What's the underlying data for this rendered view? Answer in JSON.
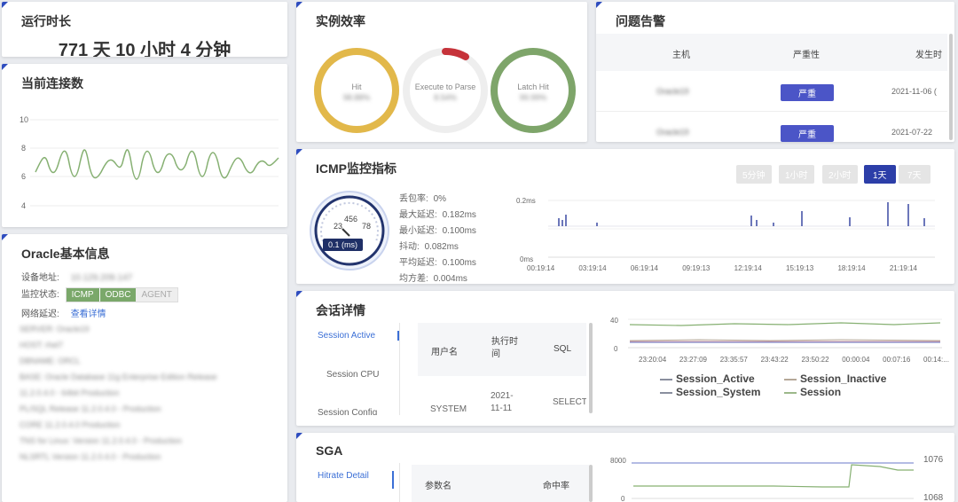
{
  "uptime": {
    "title": "运行时长",
    "value": "771 天 10 小时 4 分钟"
  },
  "connections": {
    "title": "当前连接数",
    "y_ticks": [
      "10",
      "8",
      "6",
      "4"
    ]
  },
  "oracle_info": {
    "title": "Oracle基本信息",
    "device_label": "设备地址:",
    "device_value": "10.129.209.147",
    "monitor_label": "监控状态:",
    "monitor_states": [
      "ICMP",
      "ODBC",
      "AGENT"
    ],
    "network_label": "网络延迟:",
    "network_link": "查看详情",
    "blurred_lines": [
      "SERVER: Oracle19",
      "HOST: rhel7",
      "DBNAME: ORCL",
      "BASE: Oracle Database 11g Enterprise Edition Release",
      "11.2.0.4.0 - 64bit Production",
      "PL/SQL Release 11.2.0.4.0 - Production",
      "CORE 11.2.0.4.0 Production",
      "TNS for Linux: Version 11.2.0.4.0 - Production",
      "NLSRTL Version 11.2.0.4.0 - Production"
    ]
  },
  "efficiency": {
    "title": "实例效率",
    "rings": [
      {
        "label": "Hit",
        "value": "98.88%",
        "color": "#e2b84a",
        "percent": 100
      },
      {
        "label": "Execute to Parse",
        "value": "8.54%",
        "color": "#c6333a",
        "percent": 8
      },
      {
        "label": "Latch Hit",
        "value": "99.99%",
        "color": "#7ea56a",
        "percent": 100
      }
    ]
  },
  "alerts": {
    "title": "问题告警",
    "headers": [
      "主机",
      "严重性",
      "发生时"
    ],
    "rows": [
      {
        "host": "Oracle19",
        "severity": "严重",
        "time": "2021-11-06 ("
      },
      {
        "host": "Oracle19",
        "severity": "严重",
        "time": "2021-07-22"
      }
    ]
  },
  "icmp": {
    "title": "ICMP监控指标",
    "ranges": [
      "5分钟",
      "1小时",
      "2小时",
      "1天",
      "7天"
    ],
    "active_range": "1天",
    "gauge_value": "0.1 (ms)",
    "stats": [
      {
        "label": "丢包率:",
        "value": "0%"
      },
      {
        "label": "最大延迟:",
        "value": "0.182ms"
      },
      {
        "label": "最小延迟:",
        "value": "0.100ms"
      },
      {
        "label": "抖动:",
        "value": "0.082ms"
      },
      {
        "label": "平均延迟:",
        "value": "0.100ms"
      },
      {
        "label": "均方差:",
        "value": "0.004ms"
      }
    ],
    "y_ticks": [
      "0.2ms",
      "0ms"
    ],
    "x_ticks": [
      "00:19:14",
      "03:19:14",
      "06:19:14",
      "09:19:13",
      "12:19:14",
      "15:19:13",
      "18:19:14",
      "21:19:14"
    ]
  },
  "sessions": {
    "title": "会话详情",
    "tabs": [
      "Session Active",
      "Session CPU",
      "Session Config"
    ],
    "headers": [
      "用户名",
      "执行时间",
      "SQL"
    ],
    "row": {
      "user": "SYSTEM",
      "time": "2021-11-11",
      "sql": "SELECT"
    },
    "y_ticks": [
      "40",
      "0"
    ],
    "x_ticks": [
      "23:20:04",
      "23:27:09",
      "23:35:57",
      "23:43:22",
      "23:50:22",
      "00:00:04",
      "00:07:16",
      "00:14:..."
    ],
    "legend": [
      "Session_Active",
      "Session_Inactive",
      "Session_System",
      "Session"
    ]
  },
  "sga": {
    "title": "SGA",
    "tab": "Hitrate Detail",
    "headers": [
      "参数名",
      "命中率"
    ],
    "y_left": [
      "8000",
      "0"
    ],
    "y_right": [
      "1076",
      "1068"
    ]
  }
}
